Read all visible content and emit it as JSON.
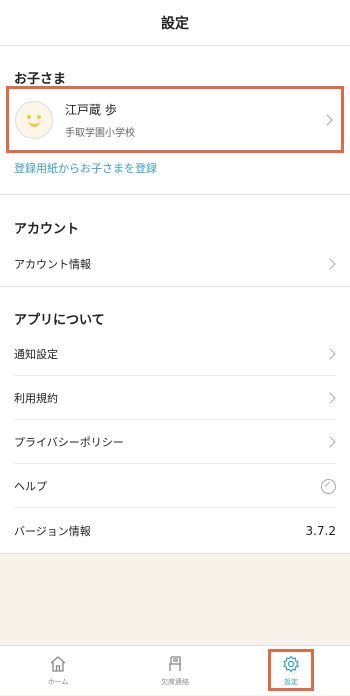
{
  "header": {
    "title": "設定"
  },
  "children_section": {
    "title": "お子さま",
    "child": {
      "name": "江戸蔵 歩",
      "school": "手取学園小学校"
    },
    "register_link": "登録用紙からお子さまを登録"
  },
  "account_section": {
    "title": "アカウント",
    "items": [
      {
        "label": "アカウント情報"
      }
    ]
  },
  "app_section": {
    "title": "アプリについて",
    "items": [
      {
        "label": "通知設定"
      },
      {
        "label": "利用規約"
      },
      {
        "label": "プライバシーポリシー"
      },
      {
        "label": "ヘルプ"
      },
      {
        "label": "バージョン情報",
        "value": "3.7.2"
      }
    ]
  },
  "tabbar": {
    "tabs": [
      {
        "label": "ホーム",
        "icon": "home-icon"
      },
      {
        "label": "欠席連絡",
        "icon": "chair-icon"
      },
      {
        "label": "設定",
        "icon": "gear-icon"
      }
    ],
    "active_color": "#3aa0c8"
  },
  "colors": {
    "highlight": "#e06a47",
    "link": "#3aa0c8",
    "footer_bg": "#f7f3ea"
  }
}
